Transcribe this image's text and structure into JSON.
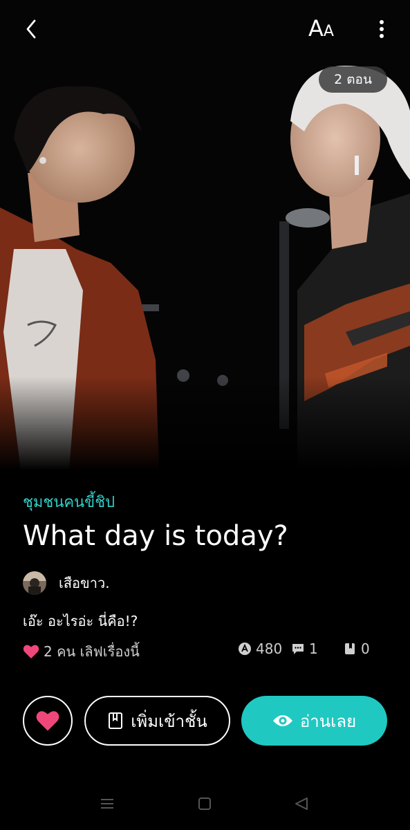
{
  "header": {
    "font_size_label_big": "A",
    "font_size_label_small": "A",
    "episodes_badge": "2 ตอน"
  },
  "story": {
    "category": "ชุมชนคนขี้ชิป",
    "title": "What day is today?",
    "author": "เสือขาว.",
    "description": "เอ๊ะ อะไรอ่ะ นี่คือ!?"
  },
  "stats": {
    "likes_label": "2 คน เลิฟเรื่องนี้",
    "views": "480",
    "comments": "1",
    "bookmarks": "0"
  },
  "actions": {
    "add_to_shelf_label": "เพิ่มเข้าชั้น",
    "read_now_label": "อ่านเลย"
  },
  "colors": {
    "accent": "#20c8c2",
    "category": "#2fd1c8",
    "heart": "#f0477a"
  },
  "icons": {
    "back": "chevron-left-icon",
    "more": "more-vertical-icon",
    "heart": "heart-icon",
    "book": "book-icon",
    "eye": "eye-icon",
    "views": "view-count-icon",
    "comments": "comment-icon",
    "bookmarks": "bookmark-icon"
  }
}
